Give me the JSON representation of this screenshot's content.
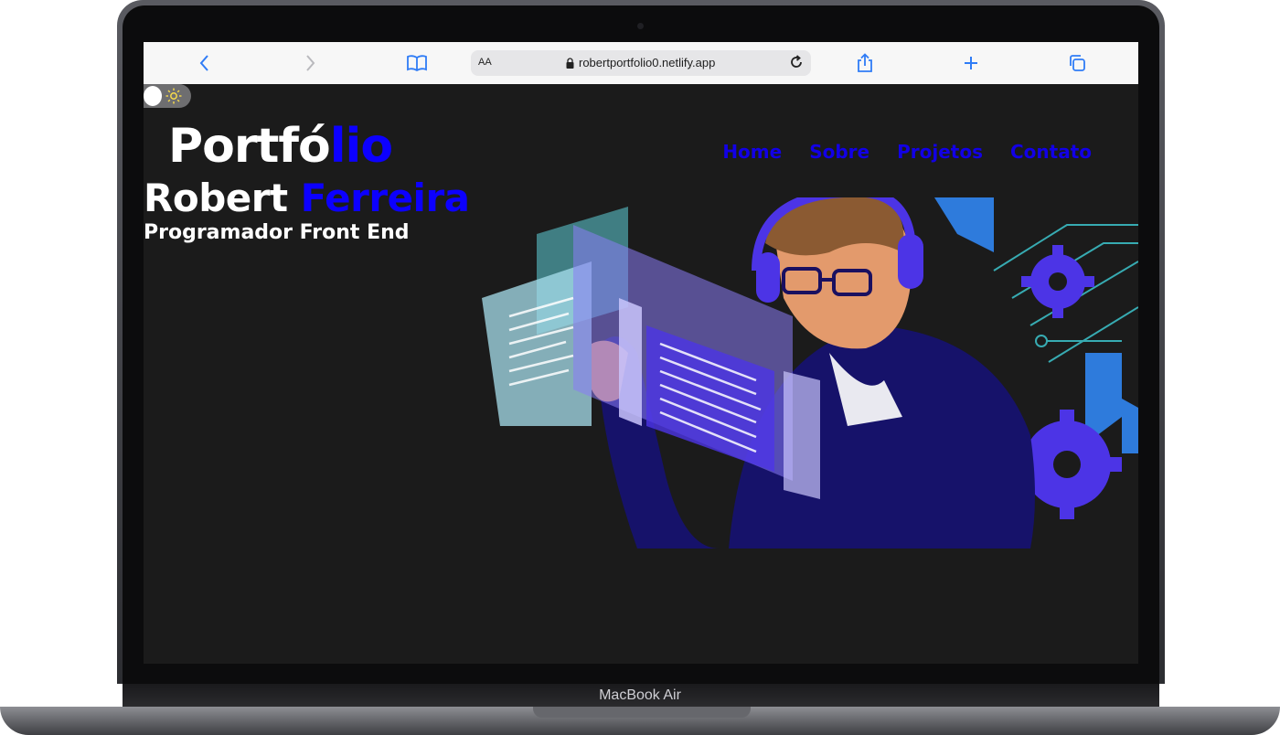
{
  "device": {
    "label": "MacBook Air"
  },
  "browser": {
    "text_size_label": "AA",
    "url": "robertportfolio0.netlify.app",
    "icons": [
      "back-icon",
      "forward-icon",
      "bookmarks-icon",
      "lock-icon",
      "reload-icon",
      "share-icon",
      "new-tab-icon",
      "tabs-icon"
    ]
  },
  "theme_toggle": {
    "icon": "sun-icon"
  },
  "brand": {
    "part1": "Portfó",
    "part2": "lio"
  },
  "hero": {
    "first_name": "Robert",
    "last_name": "Ferreira",
    "role": "Programador Front End"
  },
  "nav": {
    "items": [
      {
        "label": "Home"
      },
      {
        "label": "Sobre"
      },
      {
        "label": "Projetos"
      },
      {
        "label": "Contato"
      }
    ]
  },
  "colors": {
    "accent": "#0c00ff",
    "background": "#1b1b1b",
    "nav": "#1200e6"
  }
}
